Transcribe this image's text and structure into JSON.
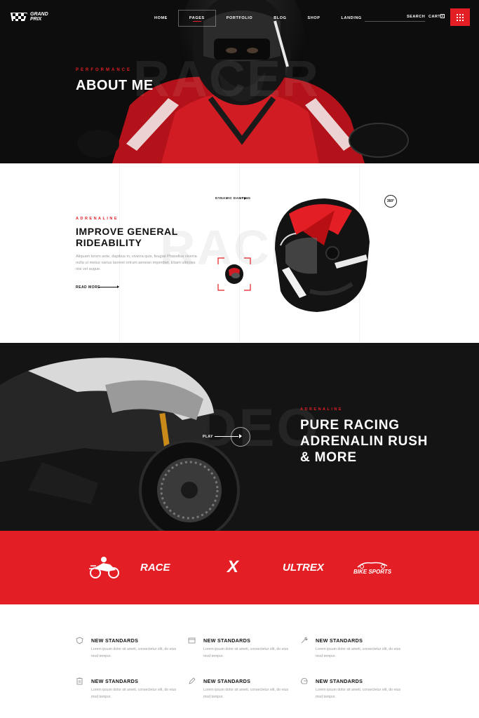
{
  "brand": {
    "line1": "GRAND",
    "line2": "PRIX"
  },
  "nav": {
    "items": [
      "HOME",
      "PAGES",
      "PORTFOLIO",
      "BLOG",
      "SHOP",
      "LANDING"
    ],
    "search": "SEARCH",
    "cart": "CART",
    "cart_count": "0",
    "accent": "#e31e24"
  },
  "hero": {
    "kicker": "PERFORMANCE",
    "title": "ABOUT ME",
    "bg_word": "RACER"
  },
  "product": {
    "kicker": "ADRENALINE",
    "title": "IMPROVE GENERAL RIDEABILITY",
    "body": "Aliquam lorem ante, dapibus in, viverra quis, feugiat Phasellus viverra nulla ut metus varius laoreet ortrum aenean imperdiet. Etiam ultricies nisi vel augue.",
    "read_more": "READ MORE",
    "hotspot": "DYNAMIC DAMPING",
    "badge": "360°",
    "bg_word": "RACING"
  },
  "video": {
    "kicker": "ADRENALINE",
    "title": "PURE RACING ADRENALIN RUSH & MORE",
    "play": "PLAY",
    "bg_word": "VIDEO"
  },
  "brands": [
    "RACE",
    "X",
    "ULTREX",
    "BIKE SPORTS"
  ],
  "features": [
    {
      "title": "NEW STANDARDS",
      "body": "Lorem ipsum dolor sit ameti, consectetur elit, do eius mod tempor.",
      "icon": "shield-icon"
    },
    {
      "title": "NEW STANDARDS",
      "body": "Lorem ipsum dolor sit ameti, consectetur elit, do eius mod tempor.",
      "icon": "window-icon"
    },
    {
      "title": "NEW STANDARDS",
      "body": "Lorem ipsum dolor sit ameti, consectetur elit, do eius mod tempor.",
      "icon": "wrench-icon"
    },
    {
      "title": "NEW STANDARDS",
      "body": "Lorem ipsum dolor sit ameti, consectetur elit, do eius mod tempor.",
      "icon": "clipboard-icon"
    },
    {
      "title": "NEW STANDARDS",
      "body": "Lorem ipsum dolor sit ameti, consectetur elit, do eius mod tempor.",
      "icon": "pen-icon"
    },
    {
      "title": "NEW STANDARDS",
      "body": "Lorem ipsum dolor sit ameti, consectetur elit, do eius mod tempor.",
      "icon": "helmet-icon"
    }
  ]
}
